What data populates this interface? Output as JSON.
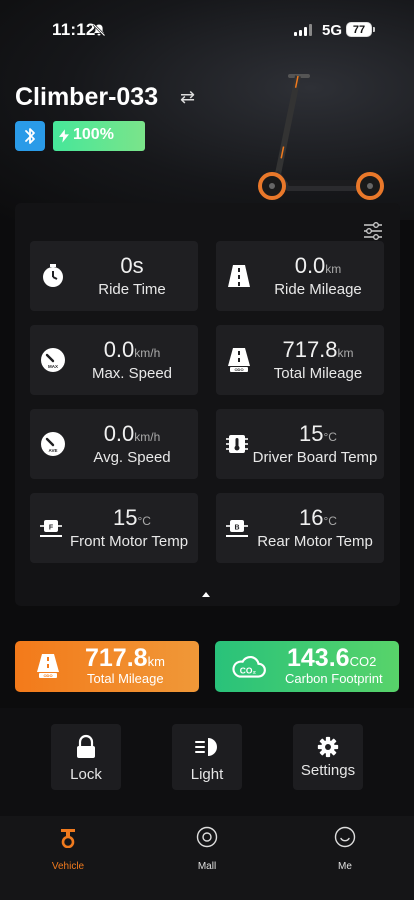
{
  "status_bar": {
    "time": "11:12",
    "network": "5G",
    "battery": "77"
  },
  "vehicle": {
    "name": "Climber-033",
    "battery_percent": "100%"
  },
  "colors": {
    "accent": "#f07a1e",
    "bluetooth": "#2a9be8",
    "battery": "#46e79a",
    "card": "#1f1f22"
  },
  "stats": [
    {
      "icon": "stopwatch-icon",
      "value": "0s",
      "unit": "",
      "label": "Ride Time"
    },
    {
      "icon": "road-icon",
      "value": "0.0",
      "unit": "km",
      "label": "Ride Mileage"
    },
    {
      "icon": "max-speed-gauge-icon",
      "value": "0.0",
      "unit": "km/h",
      "label": "Max. Speed"
    },
    {
      "icon": "odometer-road-icon",
      "value": "717.8",
      "unit": "km",
      "label": "Total Mileage"
    },
    {
      "icon": "avg-speed-gauge-icon",
      "value": "0.0",
      "unit": "km/h",
      "label": "Avg. Speed"
    },
    {
      "icon": "chip-thermometer-icon",
      "value": "15",
      "unit": "°C",
      "label": "Driver Board Temp"
    },
    {
      "icon": "front-motor-icon",
      "value": "15",
      "unit": "°C",
      "label": "Front Motor Temp"
    },
    {
      "icon": "rear-motor-icon",
      "value": "16",
      "unit": "°C",
      "label": "Rear Motor Temp"
    }
  ],
  "summary": {
    "mileage": {
      "value": "717.8",
      "unit": "km",
      "label": "Total Mileage"
    },
    "carbon": {
      "value": "143.6",
      "unit": "CO2",
      "label": "Carbon Footprint"
    }
  },
  "controls": {
    "lock": "Lock",
    "light": "Light",
    "settings": "Settings"
  },
  "tabs": {
    "vehicle": "Vehicle",
    "mall": "Mall",
    "me": "Me"
  }
}
